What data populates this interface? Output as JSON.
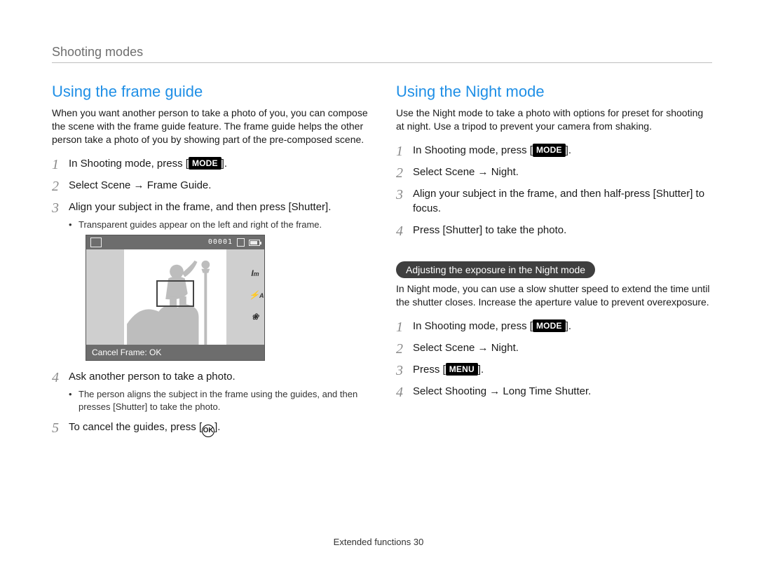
{
  "running_head": "Shooting modes",
  "footer": {
    "label": "Extended functions",
    "page": "30"
  },
  "left": {
    "heading": "Using the frame guide",
    "lead": "When you want another person to take a photo of you, you can compose the scene with the frame guide feature. The frame guide helps the other person take a photo of you by showing part of the pre-composed scene.",
    "steps": [
      {
        "pre": "In Shooting mode, press [",
        "key": "MODE",
        "post": "]."
      },
      {
        "text": "Select Scene → Frame Guide."
      },
      {
        "text": "Align your subject in the frame, and then press [Shutter].",
        "sub": [
          "Transparent guides appear on the left and right of the frame."
        ]
      },
      {
        "text": "Ask another person to take a photo.",
        "sub": [
          "The person aligns the subject in the frame using the guides, and then presses [Shutter] to take the photo."
        ]
      },
      {
        "pre": "To cancel the guides, press [",
        "icon": "ok-icon",
        "post": "]."
      }
    ],
    "illus": {
      "counter": "00001",
      "bottom": "Cancel Frame: OK"
    }
  },
  "right": {
    "heading": "Using the Night mode",
    "lead": "Use the Night mode to take a photo with options for preset for shooting at night. Use a tripod to prevent your camera from shaking.",
    "steps": [
      {
        "pre": "In Shooting mode, press [",
        "key": "MODE",
        "post": "]."
      },
      {
        "text": "Select Scene → Night."
      },
      {
        "text": "Align your subject in the frame, and then half-press [Shutter] to focus."
      },
      {
        "text": "Press [Shutter] to take the photo."
      }
    ],
    "subsection": {
      "pill": "Adjusting the exposure in the Night mode",
      "lead": "In Night mode, you can use a slow shutter speed to extend the time until the shutter closes. Increase the aperture value to prevent overexposure.",
      "steps": [
        {
          "pre": "In Shooting mode, press [",
          "key": "MODE",
          "post": "]."
        },
        {
          "text": "Select Scene → Night."
        },
        {
          "pre": "Press [",
          "key": "MENU",
          "post": "]."
        },
        {
          "text": "Select Shooting → Long Time Shutter."
        }
      ]
    }
  },
  "keys": {
    "mode": "MODE",
    "menu": "MENU",
    "ok": "OK"
  }
}
